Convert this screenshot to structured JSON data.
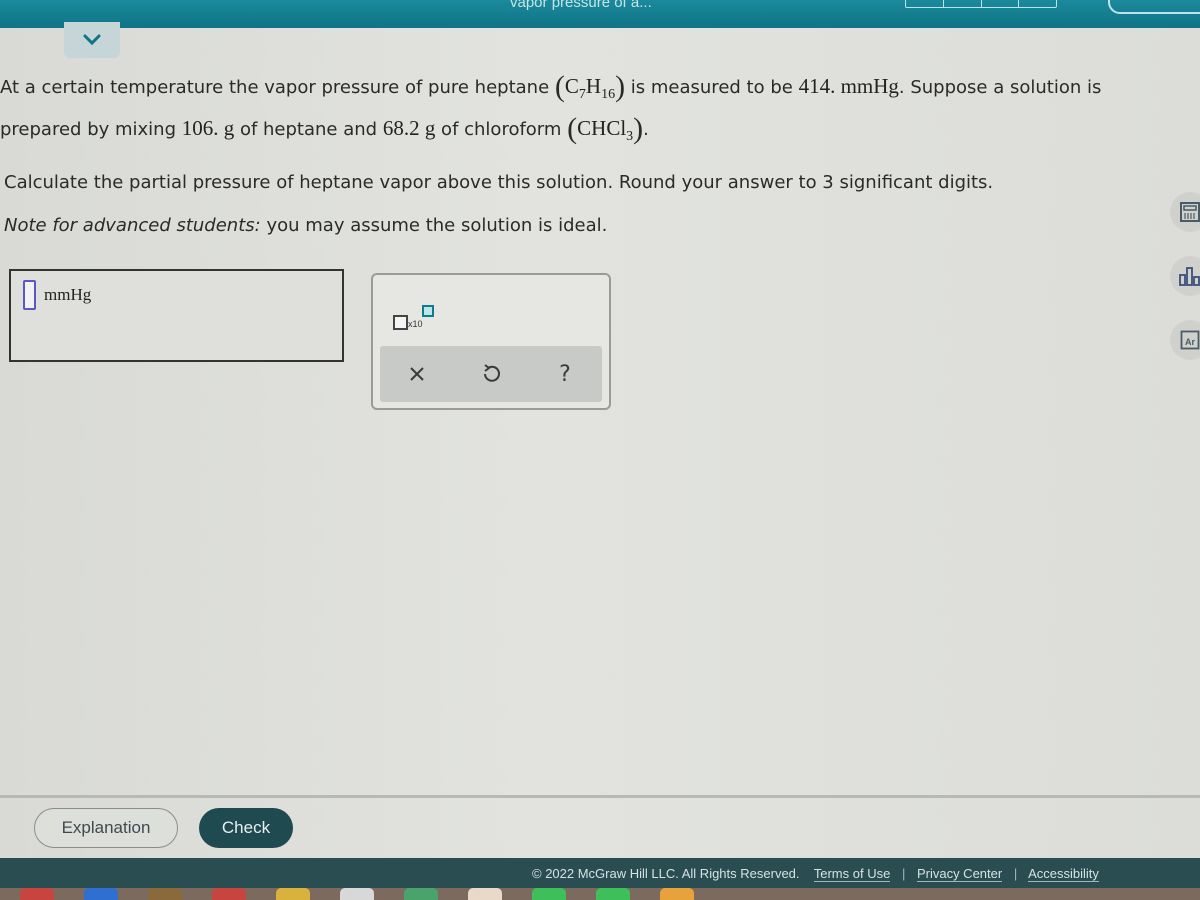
{
  "header": {
    "title_fragment": "vapor pressure of a...",
    "collapse_icon": "chevron-down-icon"
  },
  "question": {
    "line1_a": "At a certain temperature the vapor pressure of pure heptane",
    "heptane_C": "C",
    "heptane_C_sub": "7",
    "heptane_H": "H",
    "heptane_H_sub": "16",
    "line1_b": " is measured to be ",
    "pressure_value": "414. mmHg",
    "line1_c": ". Suppose a solution is",
    "line2_a": "prepared by mixing ",
    "heptane_mass": "106. g",
    "line2_b": " of heptane and ",
    "chloroform_mass": "68.2 g",
    "line2_c": " of chloroform ",
    "chloroform_formula": "CHCl",
    "chloroform_sub": "3",
    "line2_end": "."
  },
  "instruction": "Calculate the partial pressure of heptane vapor above this solution. Round your answer to 3 significant digits.",
  "note": {
    "label": "Note for advanced students:",
    "text": " you may assume the solution is ideal."
  },
  "answer": {
    "value": "",
    "unit": "mmHg"
  },
  "tool_panel": {
    "sci_notation_label": "x10",
    "clear_symbol": "×",
    "undo_symbol": "↺",
    "help_symbol": "?"
  },
  "side_tools": [
    {
      "name": "calculator-icon"
    },
    {
      "name": "bar-chart-icon"
    },
    {
      "name": "periodic-table-icon",
      "text": "Ar"
    }
  ],
  "buttons": {
    "explanation": "Explanation",
    "check": "Check"
  },
  "footer": {
    "copyright": "© 2022 McGraw Hill LLC. All Rights Reserved.",
    "terms": "Terms of Use",
    "privacy": "Privacy Center",
    "accessibility": "Accessibility",
    "separator": "|"
  },
  "dock_colors": [
    "#c7453e",
    "#2f6fd1",
    "#8a6a3a",
    "#c7453e",
    "#d8b23c",
    "#d8d8d8",
    "#4aa36b",
    "#e8d9c8",
    "#3fbf5a",
    "#3fbf5a",
    "#e8a23c"
  ]
}
